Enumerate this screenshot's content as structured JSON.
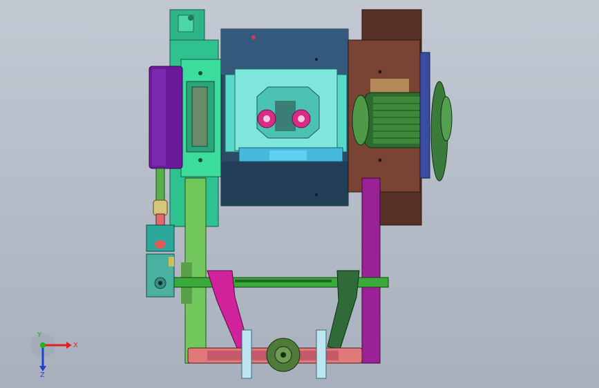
{
  "viewport": {
    "background_top": "#c2c9d3",
    "background_bottom": "#a8b0bd"
  },
  "triad": {
    "x_label": "X",
    "y_label": "Y",
    "z_label": "Z",
    "x_color": "#e02020",
    "y_color": "#20b020",
    "z_color": "#2040d0"
  },
  "parts": {
    "mount_bracket": "teal-green",
    "gearbox_housing": "dark-slate-blue",
    "gear_cover": "cyan",
    "motor_plate": "brown",
    "motor": "dark-green",
    "pulley": "dark-green",
    "side_block": "purple",
    "crank_arms": "magenta",
    "links": "light-green",
    "shaft": "green",
    "bottom_beam": "salmon",
    "hub": "olive-green"
  }
}
